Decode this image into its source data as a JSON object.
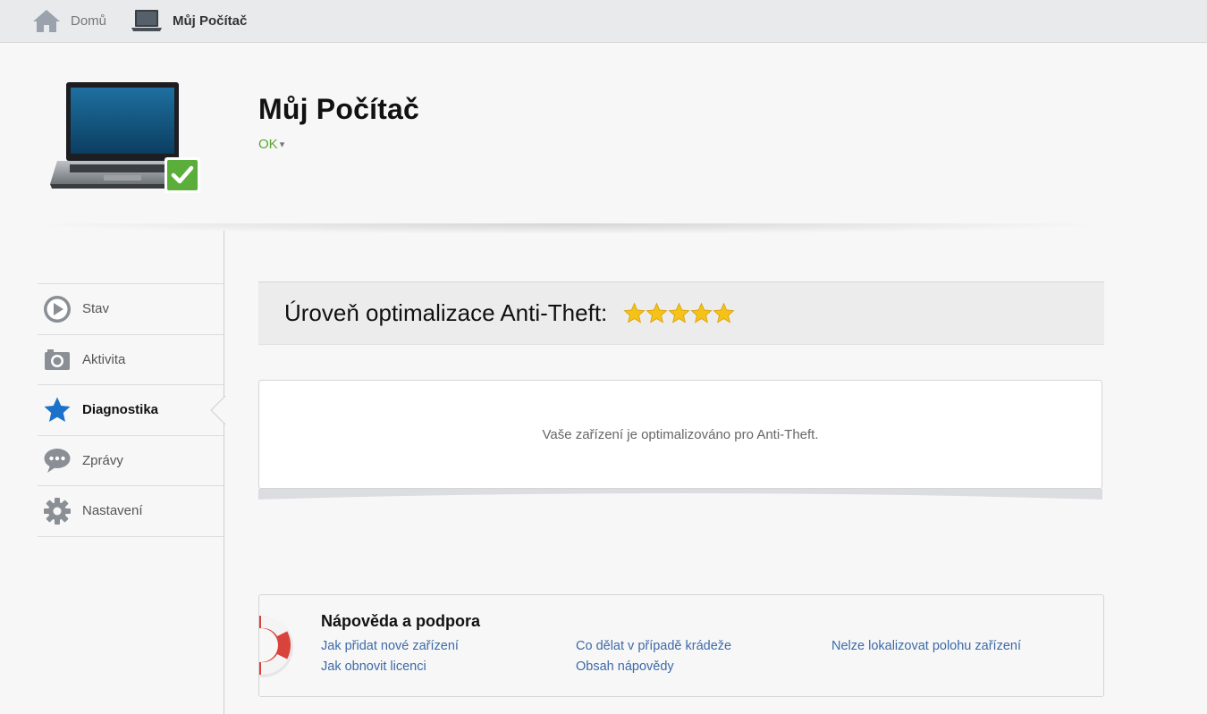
{
  "breadcrumb": {
    "home_label": "Domů",
    "current_label": "Můj Počítač"
  },
  "header": {
    "title": "Můj Počítač",
    "status": "OK",
    "status_caret": "▾"
  },
  "sidebar": {
    "items": [
      {
        "label": "Stav",
        "icon": "play-icon"
      },
      {
        "label": "Aktivita",
        "icon": "camera-icon"
      },
      {
        "label": "Diagnostika",
        "icon": "star-icon",
        "active": true
      },
      {
        "label": "Zprávy",
        "icon": "chat-bubble-icon"
      },
      {
        "label": "Nastavení",
        "icon": "gear-icon"
      }
    ]
  },
  "optimization": {
    "title": "Úroveň optimalizace Anti-Theft:",
    "rating": 5,
    "rating_max": 5
  },
  "message": {
    "text": "Vaše zařízení je optimalizováno pro Anti-Theft."
  },
  "help": {
    "title": "Nápověda a podpora",
    "links": [
      "Jak přidat nové zařízení",
      "Jak obnovit licenci",
      "Co dělat v případě krádeže",
      "Obsah nápovědy",
      "Nelze lokalizovat polohu zařízení"
    ]
  },
  "colors": {
    "status_ok": "#5ba534",
    "link": "#3d6aa8",
    "active_icon": "#1a73c9",
    "star": "#f5c21a"
  }
}
